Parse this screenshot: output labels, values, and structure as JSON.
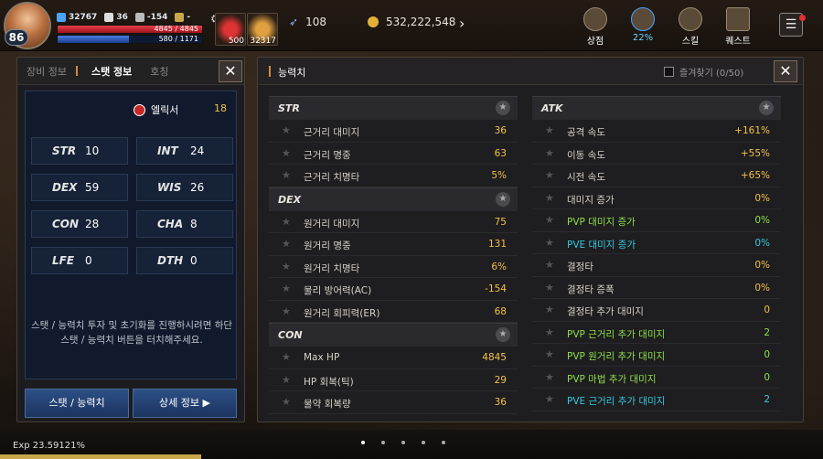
{
  "hud": {
    "level": "86",
    "combat_power": "32767",
    "stat_a": "36",
    "stat_b": "-154",
    "stat_c": "-",
    "hp_text": "4845 / 4845",
    "mp_text": "580 / 1171",
    "hp_pct": 1.0,
    "mp_pct": 0.495,
    "slot1_count": "500",
    "slot2_count": "32317",
    "gem_count": "108",
    "gold": "532,222,548",
    "menu": [
      {
        "label": "상점",
        "icon": "shop-icon"
      },
      {
        "label": "22%",
        "icon": "quest-progress-icon"
      },
      {
        "label": "스킬",
        "icon": "skill-icon"
      },
      {
        "label": "퀘스트",
        "icon": "quest-icon"
      }
    ]
  },
  "left_panel": {
    "tabs": [
      "장비 정보",
      "스탯 정보",
      "호칭"
    ],
    "active_tab": "스탯 정보",
    "elixir_label": "엘릭서",
    "elixir_value": "18",
    "stats": [
      {
        "key": "STR",
        "value": "10"
      },
      {
        "key": "INT",
        "value": "24"
      },
      {
        "key": "DEX",
        "value": "59"
      },
      {
        "key": "WIS",
        "value": "26"
      },
      {
        "key": "CON",
        "value": "28"
      },
      {
        "key": "CHA",
        "value": "8"
      },
      {
        "key": "LFE",
        "value": "0"
      },
      {
        "key": "DTH",
        "value": "0"
      }
    ],
    "hint": "스탯 / 능력치 투자 및 초기화를 진행하시려면 하단 스탯 / 능력치 버튼을 터치해주세요.",
    "btn_stats": "스탯 / 능력치",
    "btn_detail": "상세 정보"
  },
  "right_panel": {
    "title": "능력치",
    "favorites": "즐겨찾기 (0/50)",
    "sections_left": [
      {
        "title": "STR",
        "rows": [
          {
            "name": "근거리 대미지",
            "value": "36"
          },
          {
            "name": "근거리 명중",
            "value": "63"
          },
          {
            "name": "근거리 치명타",
            "value": "5%"
          }
        ]
      },
      {
        "title": "DEX",
        "rows": [
          {
            "name": "원거리 대미지",
            "value": "75"
          },
          {
            "name": "원거리 명중",
            "value": "131"
          },
          {
            "name": "원거리 치명타",
            "value": "6%"
          },
          {
            "name": "물리 방어력(AC)",
            "value": "-154"
          },
          {
            "name": "원거리 회피력(ER)",
            "value": "68"
          }
        ]
      },
      {
        "title": "CON",
        "rows": [
          {
            "name": "Max HP",
            "value": "4845"
          },
          {
            "name": "HP 회복(틱)",
            "value": "29"
          },
          {
            "name": "물약 회복량",
            "value": "36"
          }
        ]
      }
    ],
    "section_right": {
      "title": "ATK",
      "rows": [
        {
          "name": "공격 속도",
          "value": "+161%",
          "tone": ""
        },
        {
          "name": "이동 속도",
          "value": "+55%",
          "tone": ""
        },
        {
          "name": "시전 속도",
          "value": "+65%",
          "tone": ""
        },
        {
          "name": "대미지 증가",
          "value": "0%",
          "tone": ""
        },
        {
          "name": "PVP 대미지 증가",
          "value": "0%",
          "tone": "green"
        },
        {
          "name": "PVE 대미지 증가",
          "value": "0%",
          "tone": "cyan"
        },
        {
          "name": "결정타",
          "value": "0%",
          "tone": ""
        },
        {
          "name": "결정타 증폭",
          "value": "0%",
          "tone": ""
        },
        {
          "name": "결정타 추가 대미지",
          "value": "0",
          "tone": ""
        },
        {
          "name": "PVP 근거리 추가 대미지",
          "value": "2",
          "tone": "green"
        },
        {
          "name": "PVP 원거리 추가 대미지",
          "value": "0",
          "tone": "green"
        },
        {
          "name": "PVP 마법 추가 대미지",
          "value": "0",
          "tone": "green"
        },
        {
          "name": "PVE 근거리 추가 대미지",
          "value": "2",
          "tone": "cyan"
        }
      ]
    }
  },
  "footer": {
    "exp": "Exp 23.59121%"
  }
}
